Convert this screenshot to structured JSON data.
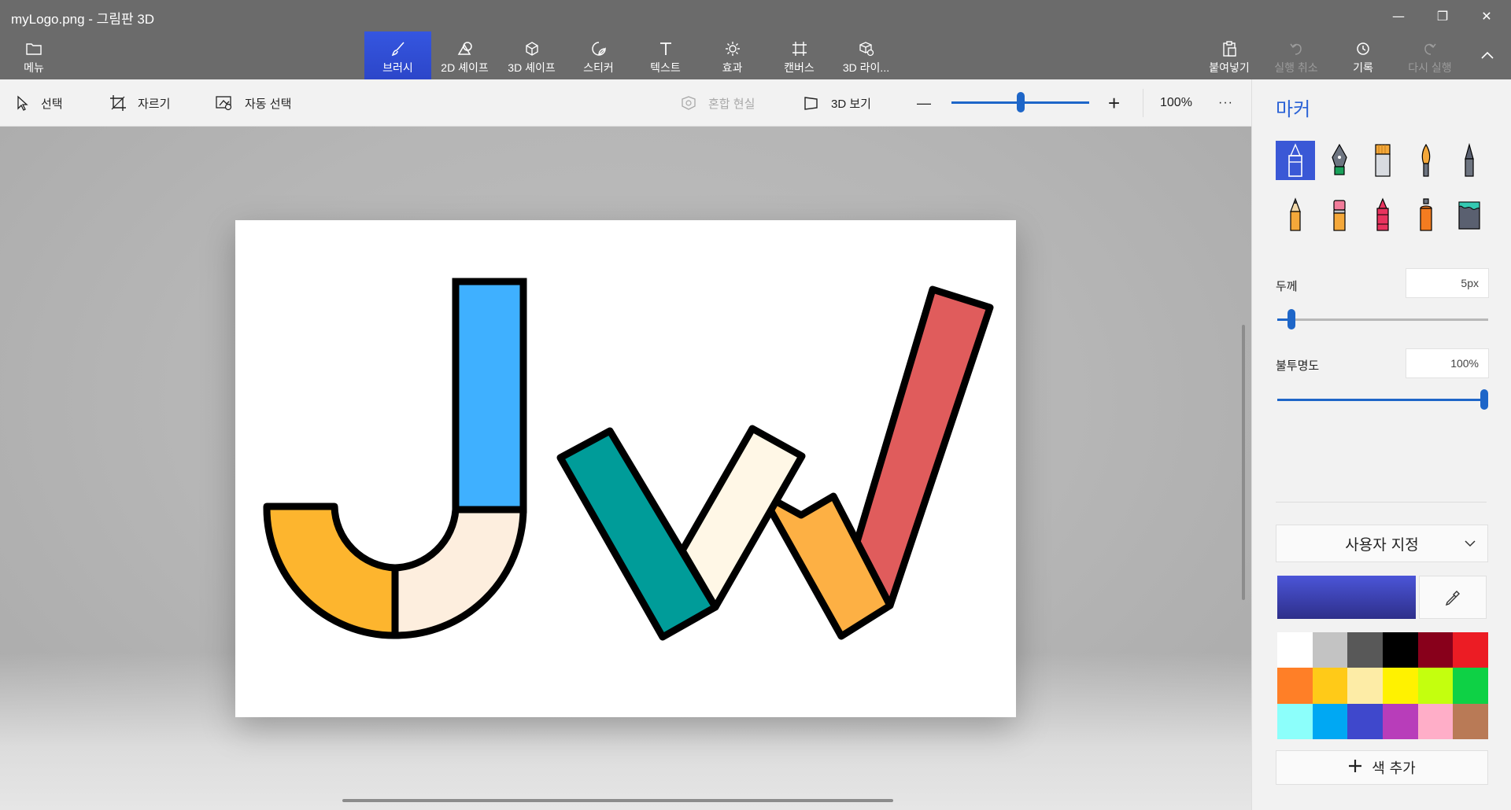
{
  "window": {
    "title": "myLogo.png - 그림판 3D",
    "minimize_glyph": "—",
    "restore_glyph": "❐",
    "close_glyph": "✕"
  },
  "ribbon": {
    "menu_label": "메뉴",
    "tabs": [
      {
        "label": "브러시",
        "icon": "brush-icon",
        "active": true
      },
      {
        "label": "2D 셰이프",
        "icon": "shapes-2d-icon"
      },
      {
        "label": "3D 셰이프",
        "icon": "shapes-3d-icon"
      },
      {
        "label": "스티커",
        "icon": "sticker-icon"
      },
      {
        "label": "텍스트",
        "icon": "text-icon"
      },
      {
        "label": "효과",
        "icon": "effects-icon"
      },
      {
        "label": "캔버스",
        "icon": "canvas-icon"
      },
      {
        "label": "3D 라이...",
        "icon": "library-3d-icon"
      }
    ],
    "paste_label": "붙여넣기",
    "undo_label": "실행 취소",
    "history_label": "기록",
    "redo_label": "다시 실행"
  },
  "toolbar": {
    "select_label": "선택",
    "crop_label": "자르기",
    "magic_select_label": "자동 선택",
    "mixed_reality_label": "혼합 현실",
    "view3d_label": "3D 보기",
    "zoom_out_glyph": "—",
    "zoom_in_glyph": "+",
    "zoom_value": "100%",
    "zoom_fraction": 0.5,
    "more_glyph": "···"
  },
  "panel": {
    "title": "마커",
    "brushes": [
      "marker",
      "calligraphy-pen",
      "oil-brush",
      "watercolor",
      "pixel-pen",
      "pencil",
      "eraser",
      "crayon",
      "spray-can",
      "fill"
    ],
    "selected_brush": "marker",
    "thickness_label": "두께",
    "thickness_value": "5px",
    "thickness_fraction": 0.05,
    "opacity_label": "불투명도",
    "opacity_value": "100%",
    "opacity_fraction": 1.0,
    "color_mode": "사용자 지정",
    "add_color_label": "색 추가",
    "palette": [
      "#ffffff",
      "#c3c3c3",
      "#585858",
      "#000000",
      "#88001b",
      "#ec1c24",
      "#ff7f27",
      "#ffca18",
      "#fdeca6",
      "#fff200",
      "#c4ff0e",
      "#0ed145",
      "#8cfffb",
      "#00a8f3",
      "#3f48cc",
      "#b83dba",
      "#ffaec8",
      "#b97a56"
    ],
    "current_color": "#4b55d8"
  },
  "canvas_art": {
    "letters": "JW",
    "colors": {
      "j_bar": "#3fb0ff",
      "j_left_curve": "#fdb52e",
      "j_right_curve": "#fdeede",
      "w_teal": "#009c99",
      "w_cream": "#fff7e6",
      "w_orange": "#fdb044",
      "w_red": "#e05c5c"
    }
  }
}
